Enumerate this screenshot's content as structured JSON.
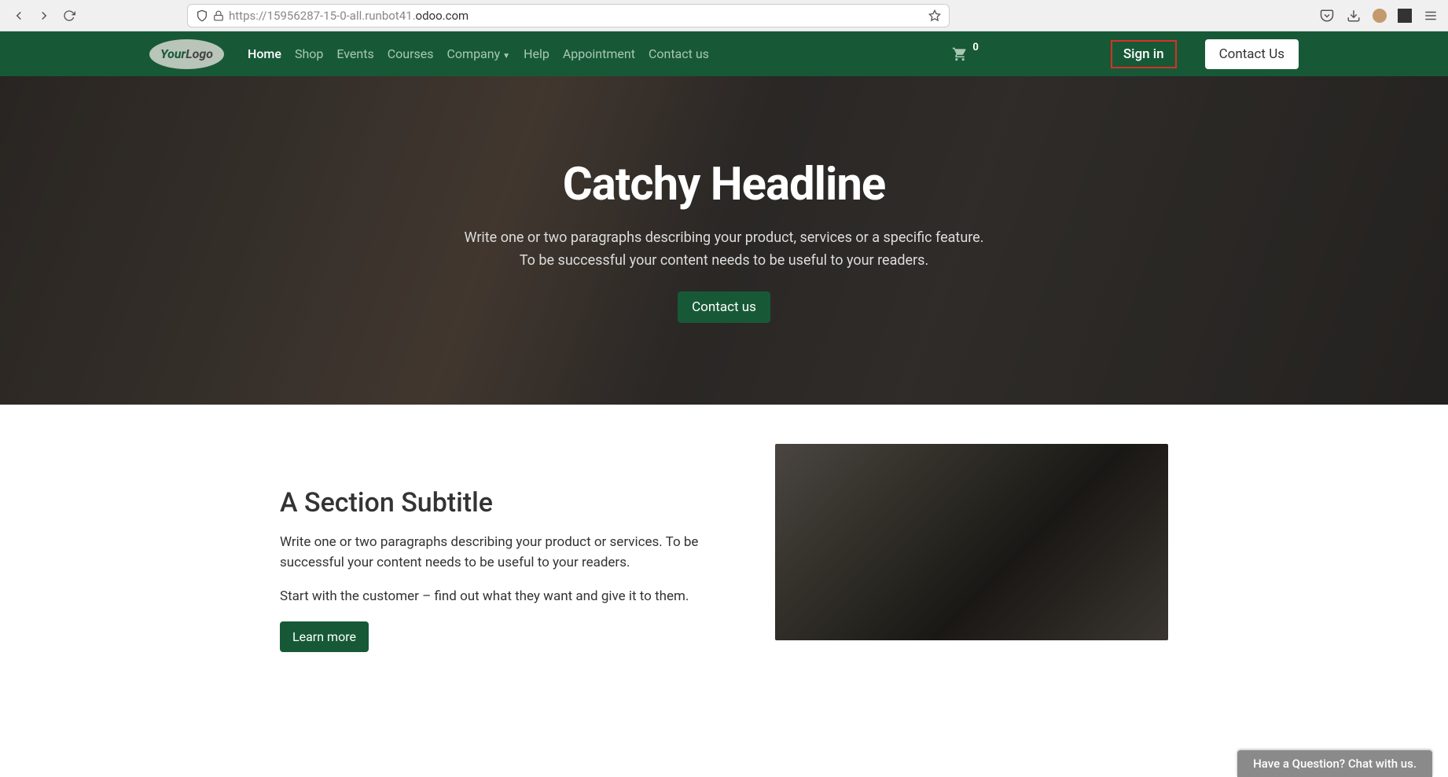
{
  "browser": {
    "url_prefix": "https://15956287-15-0-all.runbot41.",
    "url_domain": "odoo.com"
  },
  "navbar": {
    "logo_your": "Your",
    "logo_logo": "Logo",
    "links": {
      "home": "Home",
      "shop": "Shop",
      "events": "Events",
      "courses": "Courses",
      "company": "Company",
      "help": "Help",
      "appointment": "Appointment",
      "contact": "Contact us"
    },
    "cart_count": "0",
    "signin": "Sign in",
    "contact_us": "Contact Us"
  },
  "hero": {
    "headline": "Catchy Headline",
    "sub1": "Write one or two paragraphs describing your product, services or a specific feature.",
    "sub2": "To be successful your content needs to be useful to your readers.",
    "cta": "Contact us"
  },
  "section": {
    "subtitle": "A Section Subtitle",
    "p1": "Write one or two paragraphs describing your product or services. To be successful your content needs to be useful to your readers.",
    "p2": "Start with the customer – find out what they want and give it to them.",
    "learn_more": "Learn more"
  },
  "chat": {
    "label": "Have a Question? Chat with us."
  }
}
